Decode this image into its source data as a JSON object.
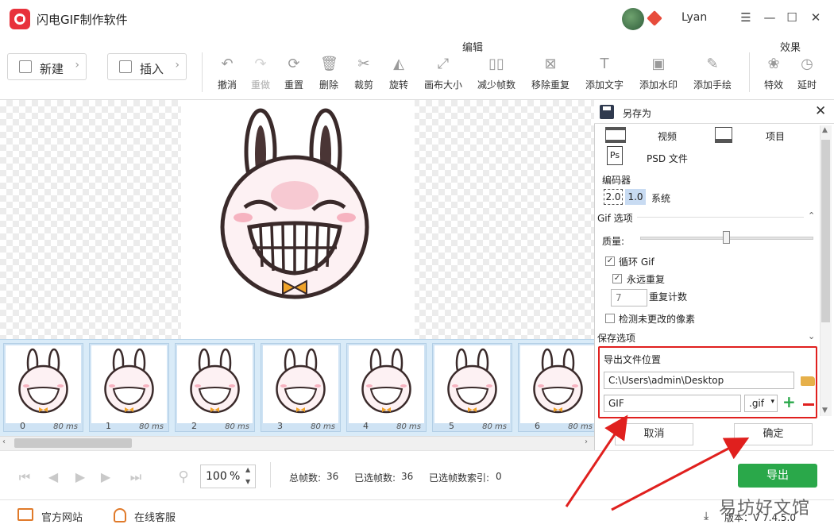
{
  "app": {
    "title": "闪电GIF制作软件",
    "user": "Lyan"
  },
  "colors": {
    "accent_green": "#2aa84a",
    "highlight_red": "#e0201e",
    "logo_red": "#e8323c"
  },
  "toolbar": {
    "new_label": "新建",
    "insert_label": "插入",
    "group_edit": "编辑",
    "group_effects": "效果",
    "tools": [
      {
        "label": "撤消",
        "icon": "undo-icon"
      },
      {
        "label": "重做",
        "icon": "redo-icon"
      },
      {
        "label": "重置",
        "icon": "reset-icon"
      },
      {
        "label": "删除",
        "icon": "trash-icon"
      },
      {
        "label": "裁剪",
        "icon": "scissors-icon"
      },
      {
        "label": "旋转",
        "icon": "rotate-icon"
      },
      {
        "label": "画布大小",
        "icon": "canvas-size-icon"
      },
      {
        "label": "减少帧数",
        "icon": "reduce-frames-icon"
      },
      {
        "label": "移除重复",
        "icon": "remove-duplicate-icon"
      },
      {
        "label": "添加文字",
        "icon": "text-icon"
      },
      {
        "label": "添加水印",
        "icon": "watermark-icon"
      },
      {
        "label": "添加手绘",
        "icon": "pencil-icon"
      },
      {
        "label": "特效",
        "icon": "effects-icon"
      },
      {
        "label": "延时",
        "icon": "timer-icon"
      }
    ]
  },
  "frames": [
    {
      "num": "0",
      "ms": "80 ms"
    },
    {
      "num": "1",
      "ms": "80 ms"
    },
    {
      "num": "2",
      "ms": "80 ms"
    },
    {
      "num": "3",
      "ms": "80 ms"
    },
    {
      "num": "4",
      "ms": "80 ms"
    },
    {
      "num": "5",
      "ms": "80 ms"
    },
    {
      "num": "6",
      "ms": "80 ms"
    }
  ],
  "playback": {
    "zoom_value": "100",
    "zoom_unit": "%",
    "total_frames_label": "总帧数:",
    "total_frames": "36",
    "selected_frames_label": "已选帧数:",
    "selected_frames": "36",
    "selected_index_label": "已选帧数索引:",
    "selected_index": "0",
    "export_label": "导出"
  },
  "footer": {
    "website": "官方网站",
    "support": "在线客服",
    "version": "版本：V 7.4.5.0",
    "watermark": "易坊好文馆"
  },
  "panel": {
    "title": "另存为",
    "format_video": "视频",
    "format_project": "项目",
    "format_psd": "PSD 文件",
    "encoder_label": "编码器",
    "encoder_v2": "2.0",
    "encoder_v1": "1.0",
    "encoder_system": "系统",
    "gif_options": "Gif 选项",
    "quality_label": "质量:",
    "quality_level": 0.5,
    "loop_gif": "循环 Gif",
    "forever": "永远重复",
    "repeat_count_value": "7",
    "repeat_count_label": "重复计数",
    "detect_unchanged": "检测未更改的像素",
    "save_options": "保存选项",
    "export_location": "导出文件位置",
    "path": "C:\\Users\\admin\\Desktop",
    "filename": "GIF",
    "ext": ".gif",
    "cancel": "取消",
    "ok": "确定"
  }
}
